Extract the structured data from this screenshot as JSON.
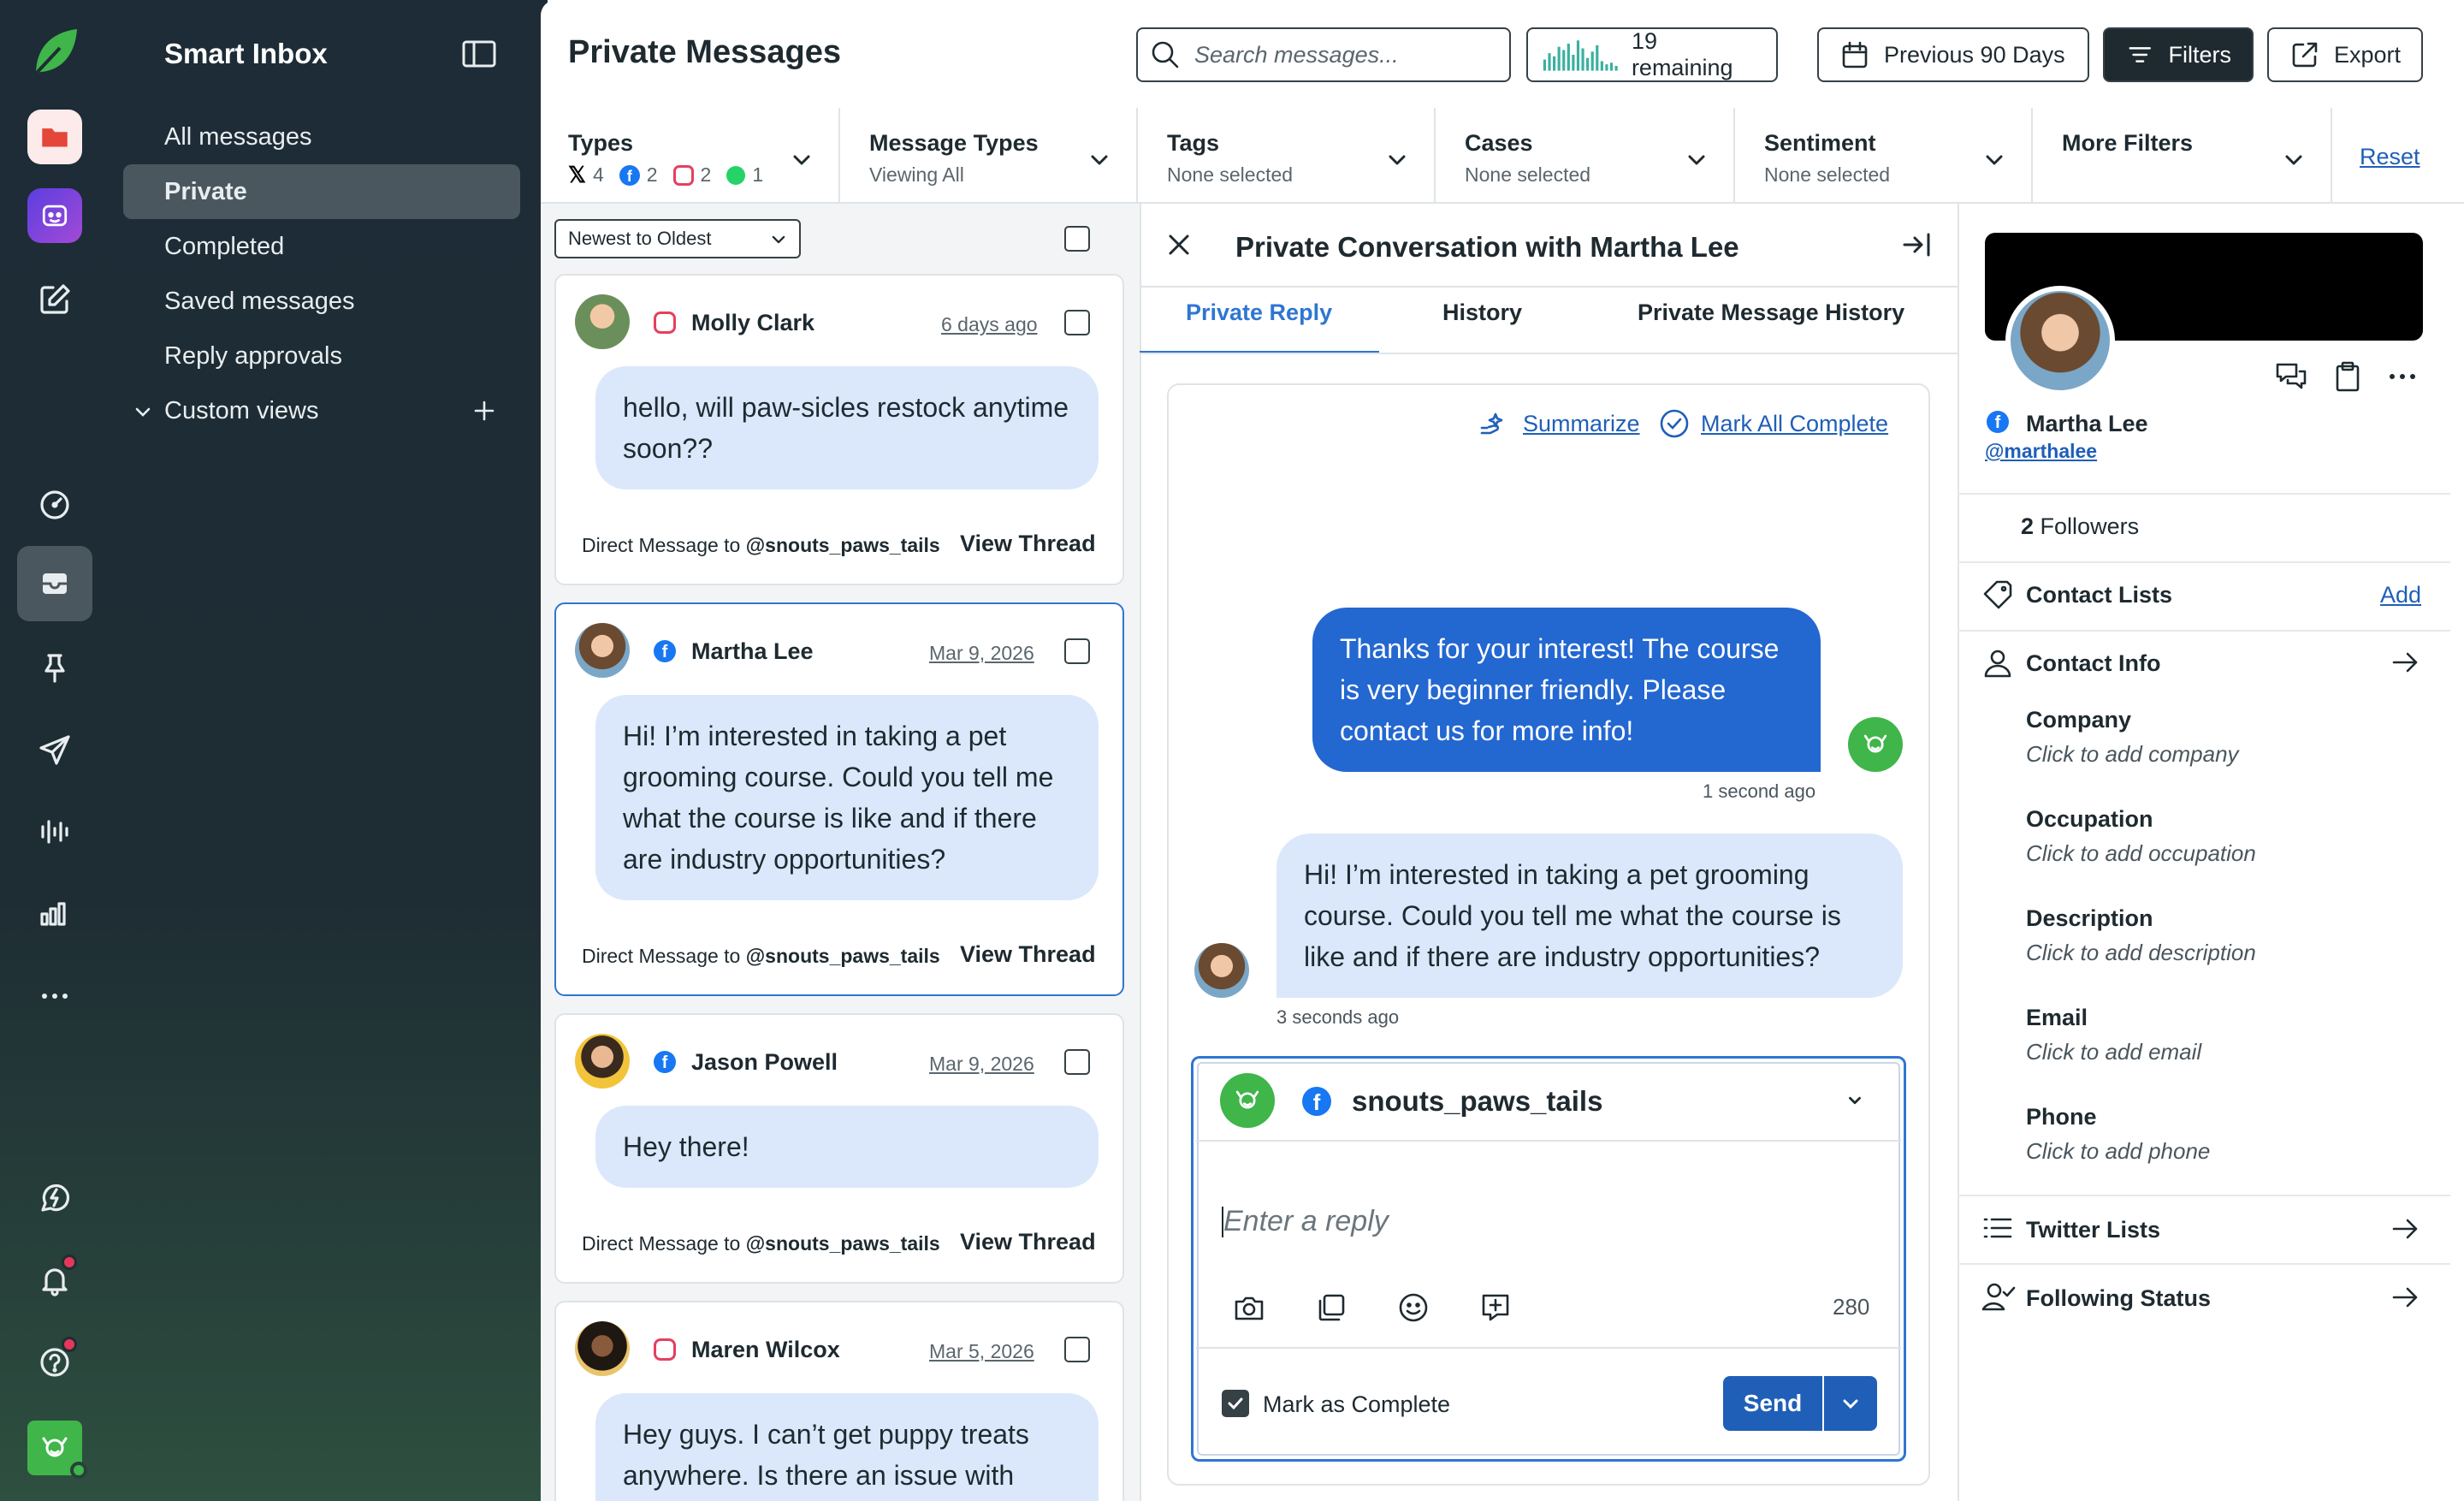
{
  "sidebar": {
    "title": "Smart Inbox",
    "items": [
      {
        "label": "All messages"
      },
      {
        "label": "Private"
      },
      {
        "label": "Completed"
      },
      {
        "label": "Saved messages"
      },
      {
        "label": "Reply approvals"
      },
      {
        "label": "Custom views"
      }
    ]
  },
  "header": {
    "title": "Private Messages",
    "search_placeholder": "Search messages...",
    "remaining": "19 remaining",
    "date_range": "Previous 90 Days",
    "filters": "Filters",
    "export": "Export"
  },
  "filters": {
    "types": {
      "title": "Types",
      "counts": [
        "4",
        "2",
        "2",
        "1"
      ]
    },
    "message_types": {
      "title": "Message Types",
      "sub": "Viewing All"
    },
    "tags": {
      "title": "Tags",
      "sub": "None selected"
    },
    "cases": {
      "title": "Cases",
      "sub": "None selected"
    },
    "sentiment": {
      "title": "Sentiment",
      "sub": "None selected"
    },
    "more": {
      "title": "More Filters"
    },
    "reset": "Reset"
  },
  "list": {
    "sort": "Newest to Oldest",
    "messages": [
      {
        "name": "Molly Clark",
        "date": "6 days ago",
        "text": "hello, will paw-sicles restock anytime soon??",
        "dm_prefix": "Direct Message to",
        "handle": "@snouts_paws_tails",
        "view": "View Thread"
      },
      {
        "name": "Martha Lee",
        "date": "Mar 9, 2026",
        "text": "Hi! I’m interested in taking a pet grooming course. Could you tell me what the course is like and if there are industry opportunities?",
        "dm_prefix": "Direct Message to",
        "handle": "@snouts_paws_tails",
        "view": "View Thread"
      },
      {
        "name": "Jason Powell",
        "date": "Mar 9, 2026",
        "text": "Hey there!",
        "dm_prefix": "Direct Message to",
        "handle": "@snouts_paws_tails",
        "view": "View Thread"
      },
      {
        "name": "Maren Wilcox",
        "date": "Mar 5, 2026",
        "text": "Hey guys. I can’t get puppy treats anywhere. Is there an issue with"
      }
    ]
  },
  "conversation": {
    "title": "Private Conversation with Martha Lee",
    "tabs": [
      "Private Reply",
      "History",
      "Private Message History"
    ],
    "summarize": "Summarize",
    "mark_all": "Mark All Complete",
    "outgoing": {
      "text": "Thanks for your interest! The course is very beginner friendly. Please contact us for more info!",
      "time": "1 second ago"
    },
    "incoming": {
      "text": "Hi! I’m interested in taking a pet grooming course. Could you tell me what the course is like and if there are industry opportunities?",
      "time": "3 seconds ago"
    },
    "composer": {
      "account": "snouts_paws_tails",
      "placeholder": "Enter a reply",
      "char_count": "280",
      "mark_complete": "Mark as Complete",
      "send": "Send"
    }
  },
  "profile": {
    "name": "Martha Lee",
    "handle": "@marthalee",
    "followers_count": "2",
    "followers_label": "Followers",
    "contact_lists": "Contact Lists",
    "add": "Add",
    "contact_info": "Contact Info",
    "fields": [
      {
        "label": "Company",
        "value": "Click to add company"
      },
      {
        "label": "Occupation",
        "value": "Click to add occupation"
      },
      {
        "label": "Description",
        "value": "Click to add description"
      },
      {
        "label": "Email",
        "value": "Click to add email"
      },
      {
        "label": "Phone",
        "value": "Click to add phone"
      }
    ],
    "twitter_lists": "Twitter Lists",
    "following_status": "Following Status"
  },
  "colors": {
    "accent": "#2f76d2",
    "brand_green": "#3fb54a",
    "send": "#1f5fb8",
    "bubble_in": "#dbe8fb",
    "bubble_out": "#2367d1"
  }
}
